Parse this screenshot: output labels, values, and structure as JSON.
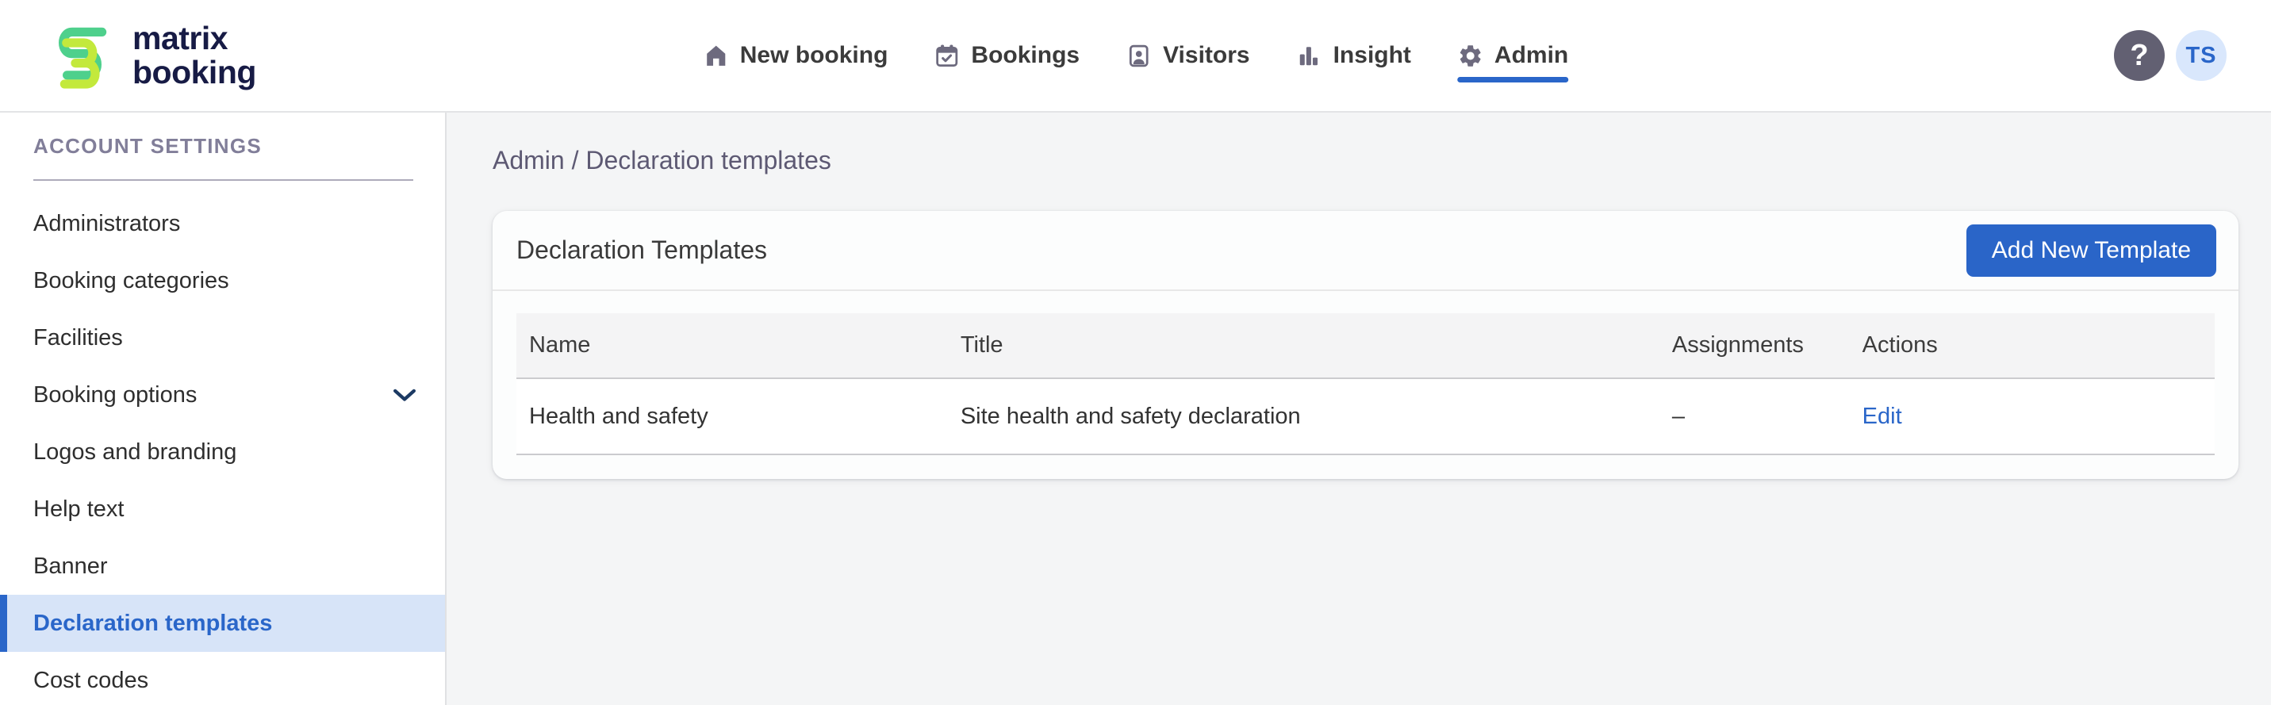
{
  "header": {
    "logo_line1": "matrix",
    "logo_line2": "booking",
    "nav": [
      {
        "label": "New booking",
        "icon": "house-icon",
        "active": false
      },
      {
        "label": "Bookings",
        "icon": "calendar-check-icon",
        "active": false
      },
      {
        "label": "Visitors",
        "icon": "visitor-badge-icon",
        "active": false
      },
      {
        "label": "Insight",
        "icon": "bar-chart-icon",
        "active": false
      },
      {
        "label": "Admin",
        "icon": "gear-icon",
        "active": true
      }
    ],
    "help_label": "?",
    "avatar_initials": "TS"
  },
  "sidebar": {
    "section_title": "ACCOUNT SETTINGS",
    "items": [
      {
        "label": "Administrators",
        "active": false
      },
      {
        "label": "Booking categories",
        "active": false
      },
      {
        "label": "Facilities",
        "active": false
      },
      {
        "label": "Booking options",
        "active": false,
        "expandable": true
      },
      {
        "label": "Logos and branding",
        "active": false
      },
      {
        "label": "Help text",
        "active": false
      },
      {
        "label": "Banner",
        "active": false
      },
      {
        "label": "Declaration templates",
        "active": true
      },
      {
        "label": "Cost codes",
        "active": false
      }
    ]
  },
  "main": {
    "breadcrumb": {
      "parts": [
        "Admin",
        "Declaration templates"
      ],
      "separator": " / "
    },
    "card": {
      "title": "Declaration Templates",
      "add_button_label": "Add New Template",
      "table": {
        "columns": [
          "Name",
          "Title",
          "Assignments",
          "Actions"
        ],
        "rows": [
          {
            "name": "Health and safety",
            "title": "Site health and safety declaration",
            "assignments": "–",
            "action": "Edit"
          }
        ]
      }
    }
  },
  "colors": {
    "accent_blue": "#2a66c9",
    "button_blue": "#2a65c8",
    "active_sidebar_bg": "#d7e4f8",
    "logo_green": "#4ed08c",
    "logo_lime": "#c3e93c",
    "nav_icon_gray": "#6d6a7e",
    "help_circle_bg": "#626072",
    "avatar_bg": "#d9e7fc",
    "page_bg": "#f4f5f6"
  }
}
